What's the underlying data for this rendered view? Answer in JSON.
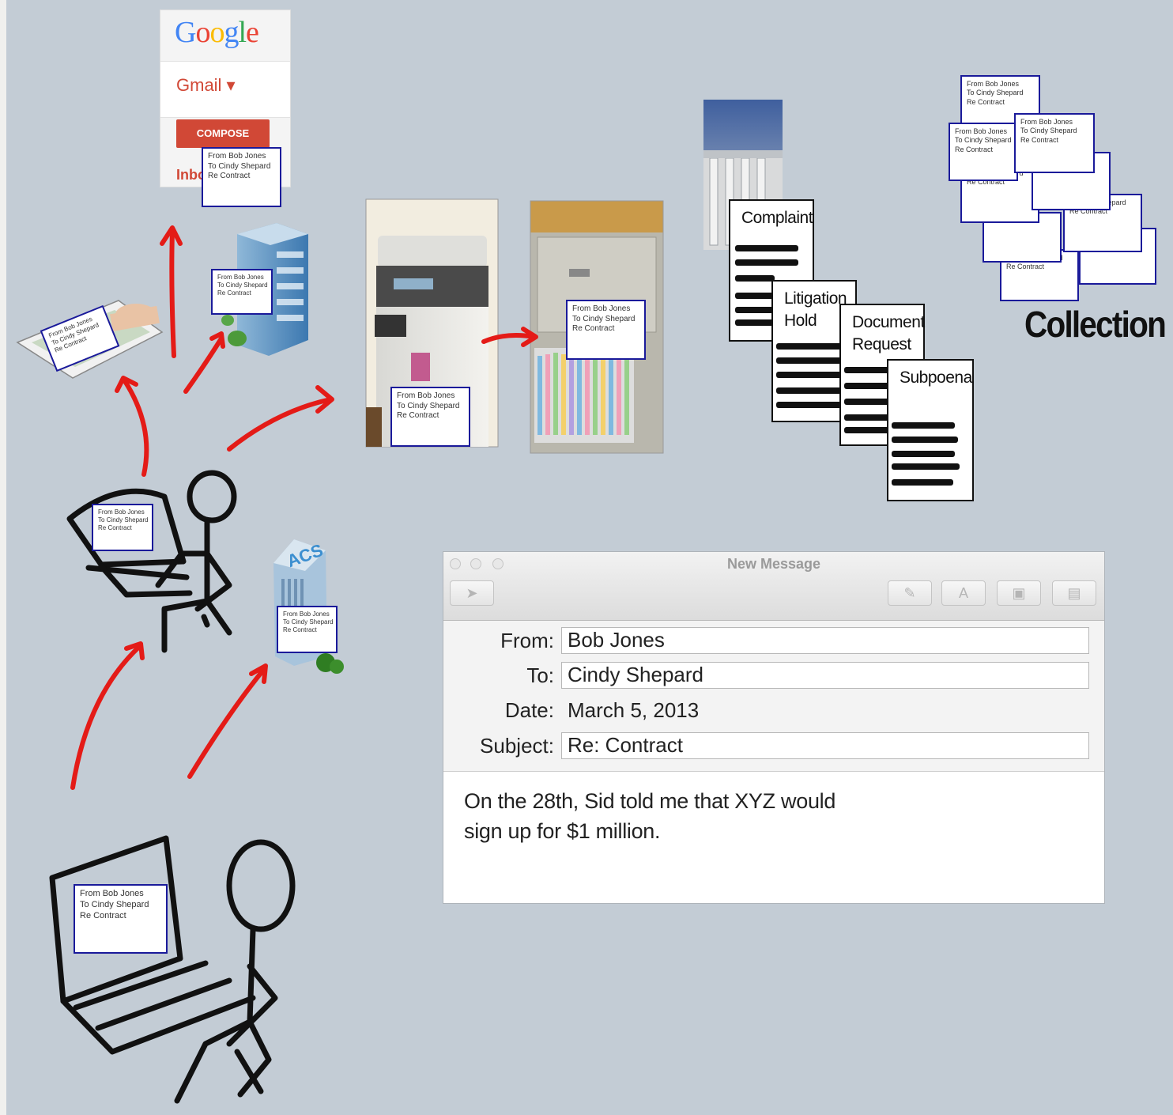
{
  "note_card": {
    "line1": "From Bob Jones",
    "line2": "To Cindy Shepard",
    "line3": "Re Contract"
  },
  "gmail": {
    "logo": "Google",
    "menu": "Gmail ▾",
    "compose": "COMPOSE",
    "inbox": "Inbox"
  },
  "building_sign": "ACS",
  "legal_docs": {
    "complaint": "Complaint",
    "litigation_hold_1": "Litigation",
    "litigation_hold_2": "Hold",
    "document_request_1": "Document",
    "document_request_2": "Request",
    "subpoena": "Subpoena"
  },
  "collection_label": "Collection",
  "mail_window": {
    "title": "New Message",
    "from_label": "From:",
    "from_value": "Bob Jones",
    "to_label": "To:",
    "to_value": "Cindy Shepard",
    "date_label": "Date:",
    "date_value": "March 5, 2013",
    "subject_label": "Subject:",
    "subject_value": "Re: Contract",
    "body_line1": "On the 28th, Sid told me that XYZ would",
    "body_line2": "sign up for $1 million."
  },
  "colors": {
    "background": "#c3ccd5",
    "arrow": "#e41b17",
    "note_border": "#1a1a9a",
    "gmail_red": "#d14836"
  }
}
